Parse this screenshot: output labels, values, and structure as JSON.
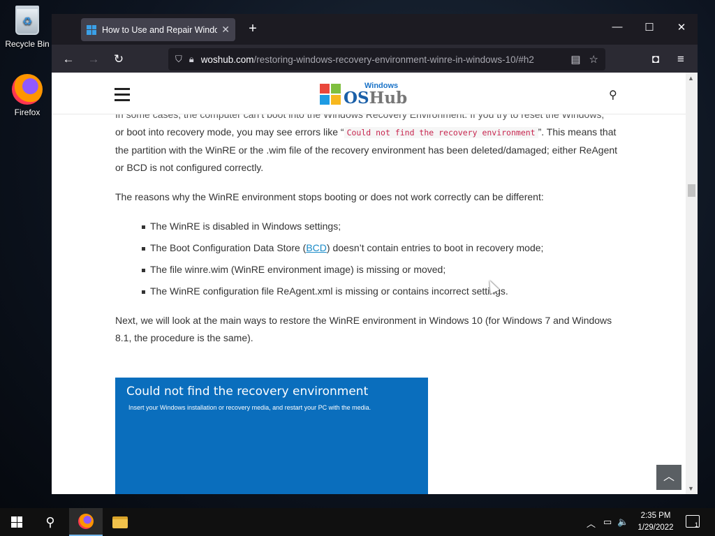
{
  "desktop": {
    "icons": [
      {
        "label": "Recycle Bin",
        "icon": "recycle-bin-icon"
      },
      {
        "label": "Firefox",
        "icon": "firefox-icon"
      }
    ]
  },
  "browser": {
    "tab": {
      "title": "How to Use and Repair Windows",
      "close": "✕",
      "favicon": "windows-logo-icon"
    },
    "newtab": "+",
    "controls": {
      "minimize": "—",
      "maximize": "☐",
      "close": "✕"
    },
    "nav": {
      "back": "←",
      "forward": "→",
      "reload": "↻"
    },
    "url": {
      "domain": "woshub.com",
      "path": "/restoring-windows-recovery-environment-winre-in-windows-10/#h2"
    },
    "toolbar_icons": {
      "reader": "▤",
      "bookmark": "☆",
      "pocket": "◘",
      "menu": "≡"
    }
  },
  "site": {
    "logo_line1": "Windows",
    "logo_line2a": "OS",
    "logo_line2b": "Hub",
    "search": "⚲",
    "colors": {
      "accent": "#1a5fa8",
      "link": "#1a8bc8",
      "code": "#c7254e"
    }
  },
  "article": {
    "p0_partial": "In some cases, the computer can’t boot into the Windows Recovery Environment. If you try to reset the Windows,",
    "p1_before": "or boot into recovery mode, you may see errors like “",
    "p1_code": "Could not find the recovery environment",
    "p1_after": "”. This means that the partition with the WinRE or the .wim file of the recovery environment has been deleted/damaged; either ReAgent or BCD is not configured correctly.",
    "p2": "The reasons why the WinRE environment stops booting or does not work correctly can be different:",
    "bullets": {
      "b1": "The WinRE is disabled in Windows settings;",
      "b2_before": "The Boot Configuration Data Store (",
      "b2_link": "BCD",
      "b2_after": ") doesn’t contain entries to boot in recovery mode;",
      "b3": "The file winre.wim (WinRE environment image) is missing or moved;",
      "b4": "The WinRE configuration file ReAgent.xml is missing or contains incorrect settings."
    },
    "p3": "Next, we will look at the main ways to restore the WinRE environment in Windows 10 (for Windows 7 and Windows 8.1, the procedure is the same).",
    "error_image": {
      "heading": "Could not find the recovery environment",
      "sub": "Insert your Windows installation or recovery media, and restart your PC with the media."
    },
    "to_top": "︿"
  },
  "taskbar": {
    "search_icon": "⚲",
    "tray": {
      "chevron": "︿",
      "network": "▭",
      "volume": "🔈"
    },
    "time": "2:35 PM",
    "date": "1/29/2022",
    "notif_count": "1"
  }
}
